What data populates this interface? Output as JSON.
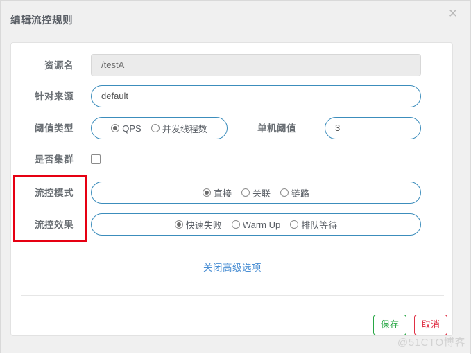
{
  "dialog": {
    "title": "编辑流控规则",
    "close_icon": "close-icon",
    "close_glyph": "✕"
  },
  "form": {
    "resource": {
      "label": "资源名",
      "value": "/testA",
      "disabled": true
    },
    "origin": {
      "label": "针对来源",
      "value": "default",
      "placeholder": "default"
    },
    "threshold_type": {
      "label": "阈值类型",
      "options": [
        {
          "label": "QPS",
          "selected": true
        },
        {
          "label": "并发线程数",
          "selected": false
        }
      ]
    },
    "single_threshold": {
      "label": "单机阈值",
      "value": "3",
      "placeholder": ""
    },
    "cluster": {
      "label": "是否集群",
      "checked": false
    },
    "flow_mode": {
      "label": "流控模式",
      "options": [
        {
          "label": "直接",
          "selected": true
        },
        {
          "label": "关联",
          "selected": false
        },
        {
          "label": "链路",
          "selected": false
        }
      ]
    },
    "flow_effect": {
      "label": "流控效果",
      "options": [
        {
          "label": "快速失败",
          "selected": true
        },
        {
          "label": "Warm Up",
          "selected": false
        },
        {
          "label": "排队等待",
          "selected": false
        }
      ]
    },
    "advanced_link": "关闭高级选项"
  },
  "footer": {
    "save_label": "保存",
    "cancel_label": "取消"
  },
  "watermark": "@51CTO博客",
  "colors": {
    "accent_border": "#3c8dbc",
    "link": "#4b8fd4",
    "save": "#28a745",
    "cancel": "#e02f44",
    "annotation": "#e60012",
    "label": "#6b7075",
    "dialog_bg": "#f0f0f0"
  }
}
